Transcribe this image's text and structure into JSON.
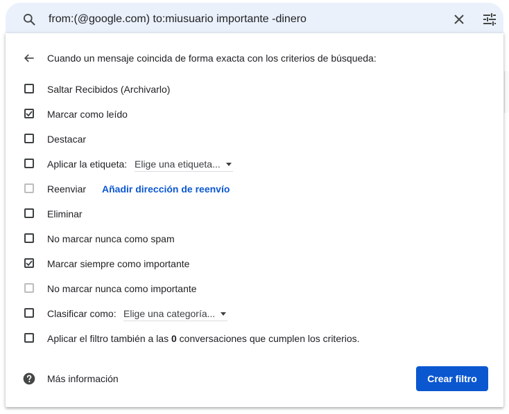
{
  "search": {
    "query": "from:(@google.com) to:miusuario importante -dinero"
  },
  "filter": {
    "header": "Cuando un mensaje coincida de forma exacta con los criterios de búsqueda:",
    "options": [
      {
        "label": "Saltar Recibidos (Archivarlo)",
        "checked": false,
        "disabled": false
      },
      {
        "label": "Marcar como leído",
        "checked": true,
        "disabled": false
      },
      {
        "label": "Destacar",
        "checked": false,
        "disabled": false
      },
      {
        "label": "Aplicar la etiqueta:",
        "checked": false,
        "disabled": false,
        "dropdown": "Elige una etiqueta..."
      },
      {
        "label": "Reenviar",
        "checked": false,
        "disabled": true,
        "link": "Añadir dirección de reenvío"
      },
      {
        "label": "Eliminar",
        "checked": false,
        "disabled": false
      },
      {
        "label": "No marcar nunca como spam",
        "checked": false,
        "disabled": false
      },
      {
        "label": "Marcar siempre como importante",
        "checked": true,
        "disabled": false
      },
      {
        "label": "No marcar nunca como importante",
        "checked": false,
        "disabled": true
      },
      {
        "label": "Clasificar como:",
        "checked": false,
        "disabled": false,
        "dropdown": "Elige una categoría..."
      },
      {
        "label_before": "Aplicar el filtro también a las ",
        "label_count": "0",
        "label_after": " conversaciones que cumplen los criterios.",
        "checked": false,
        "disabled": false
      }
    ],
    "help_text": "Más información",
    "create_button": "Crear filtro"
  },
  "icons": {
    "search": "search-icon",
    "clear": "close-icon",
    "options": "tune-icon",
    "back": "arrow-back-icon",
    "help": "help-icon"
  },
  "colors": {
    "accent": "#0b57d0",
    "search_bg": "#eaf1fb",
    "text": "#202124"
  }
}
